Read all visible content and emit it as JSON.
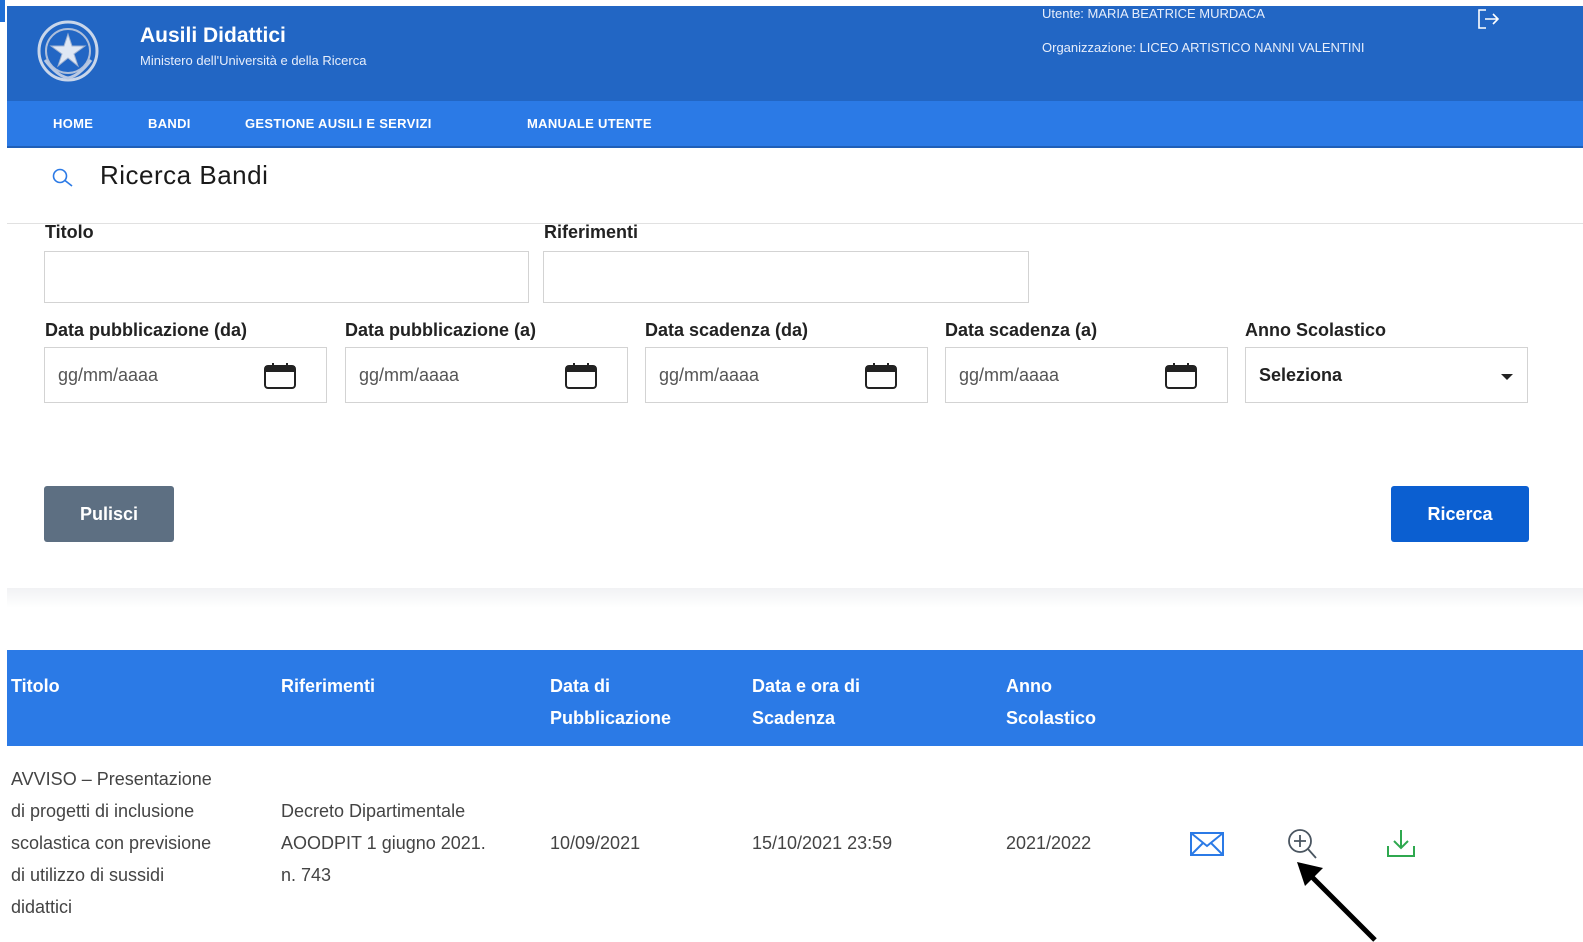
{
  "header": {
    "app_title": "Ausili Didattici",
    "app_subtitle": "Ministero dell'Università e della Ricerca",
    "user": "Utente: MARIA BEATRICE MURDACA",
    "organization": "Organizzazione: LICEO ARTISTICO NANNI VALENTINI",
    "logout_icon": "logout-icon",
    "brand_color": "#2266c4"
  },
  "nav": {
    "items": [
      "HOME",
      "BANDI",
      "GESTIONE AUSILI E SERVIZI",
      "MANUALE UTENTE"
    ],
    "color": "#2b7ae6"
  },
  "search": {
    "title": "Ricerca Bandi",
    "icon": "search-icon",
    "fields": {
      "titolo_label": "Titolo",
      "titolo_value": "",
      "riferimenti_label": "Riferimenti",
      "riferimenti_value": "",
      "pub_da_label": "Data pubblicazione (da)",
      "pub_a_label": "Data pubblicazione (a)",
      "scad_da_label": "Data scadenza (da)",
      "scad_a_label": "Data scadenza (a)",
      "anno_label": "Anno Scolastico",
      "date_placeholder": "gg/mm/aaaa",
      "anno_selected": "Seleziona"
    },
    "buttons": {
      "clear": "Pulisci",
      "search": "Ricerca"
    }
  },
  "table": {
    "headers": [
      "Titolo",
      "Riferimenti",
      "Data di Pubblicazione",
      "Data e ora di Scadenza",
      "Anno Scolastico"
    ],
    "header_lines": {
      "titolo": "Titolo",
      "riferimenti": "Riferimenti",
      "pub_1": "Data di",
      "pub_2": "Pubblicazione",
      "scad_1": "Data e ora di",
      "scad_2": "Scadenza",
      "anno_1": "Anno",
      "anno_2": "Scolastico"
    },
    "rows": [
      {
        "titolo_lines": [
          "AVVISO – Presentazione",
          "di progetti di inclusione",
          "scolastica con previsione",
          "di utilizzo di sussidi",
          "didattici"
        ],
        "riferimenti_lines": [
          "Decreto Dipartimentale",
          "AOODPIT 1 giugno 2021.",
          "n. 743"
        ],
        "data_pubblicazione": "10/09/2021",
        "data_scadenza": "15/10/2021 23:59",
        "anno_scolastico": "2021/2022",
        "actions": [
          "mail-icon",
          "zoom-in-icon",
          "download-icon"
        ]
      }
    ]
  }
}
